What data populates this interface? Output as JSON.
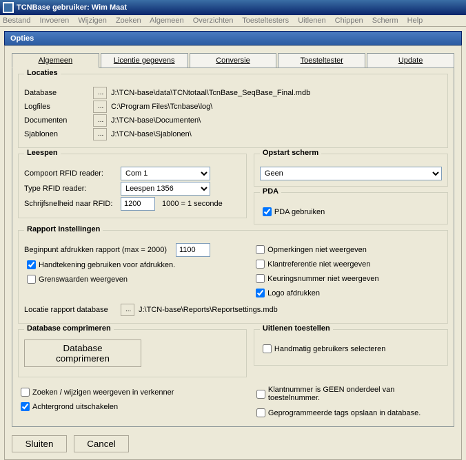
{
  "window": {
    "title": "TCNBase    gebruiker: Wim Maat"
  },
  "menu": {
    "bestand": "Bestand",
    "invoeren": "Invoeren",
    "wijzigen": "Wijzigen",
    "zoeken": "Zoeken",
    "algemeen": "Algemeen",
    "overzichten": "Overzichten",
    "toesteltesters": "Toesteltesters",
    "uitlenen": "Uitlenen",
    "chippen": "Chippen",
    "scherm": "Scherm",
    "help": "Help"
  },
  "dialog": {
    "title": "Opties"
  },
  "tabs": {
    "algemeen": "Algemeen",
    "licentie": "Licentie gegevens",
    "conversie": "Conversie",
    "toesteltester": "Toesteltester",
    "update": "Update"
  },
  "locaties": {
    "title": "Locaties",
    "database_lbl": "Database",
    "database_val": "J:\\TCN-base\\data\\TCNtotaal\\TcnBase_SeqBase_Final.mdb",
    "logfiles_lbl": "Logfiles",
    "logfiles_val": "C:\\Program Files\\Tcnbase\\log\\",
    "documenten_lbl": "Documenten",
    "documenten_val": "J:\\TCN-base\\Documenten\\",
    "sjablonen_lbl": "Sjablonen",
    "sjablonen_val": "J:\\TCN-base\\Sjablonen\\"
  },
  "leespen": {
    "title": "Leespen",
    "compoort_lbl": "Compoort RFID reader:",
    "compoort_val": "Com 1",
    "type_lbl": "Type RFID reader:",
    "type_val": "Leespen 1356",
    "schrijf_lbl": "Schrijfsnelheid naar RFID:",
    "schrijf_val": "1200",
    "schrijf_hint": "1000 = 1 seconde"
  },
  "opstart": {
    "title": "Opstart scherm",
    "value": "Geen"
  },
  "pda": {
    "title": "PDA",
    "gebruik_lbl": "PDA gebruiken"
  },
  "rapport": {
    "title": "Rapport Instellingen",
    "beginpunt_lbl": "Beginpunt afdrukken rapport (max = 2000)",
    "beginpunt_val": "1100",
    "handtekening_lbl": "Handtekening gebruiken voor afdrukken.",
    "grenswaarden_lbl": "Grenswaarden weergeven",
    "locatie_lbl": "Locatie rapport database",
    "locatie_val": "J:\\TCN-base\\Reports\\Reportsettings.mdb",
    "opmerkingen_lbl": "Opmerkingen niet weergeven",
    "klantreferentie_lbl": "Klantreferentie niet weergeven",
    "keuringsnummer_lbl": "Keuringsnummer niet weergeven",
    "logo_lbl": "Logo afdrukken"
  },
  "dbcomp": {
    "title": "Database comprimeren",
    "button": "Database comprimeren"
  },
  "uitlenen": {
    "title": "Uitlenen toestellen",
    "handmatig_lbl": "Handmatig gebruikers selecteren"
  },
  "misc": {
    "zoeken_lbl": "Zoeken / wijzigen weergeven in verkenner",
    "achtergrond_lbl": "Achtergrond uitschakelen",
    "klantnummer_lbl": "Klantnummer is GEEN onderdeel van toestelnummer.",
    "tags_lbl": "Geprogrammeerde tags opslaan in database."
  },
  "buttons": {
    "sluiten": "Sluiten",
    "cancel": "Cancel"
  },
  "dots": "..."
}
